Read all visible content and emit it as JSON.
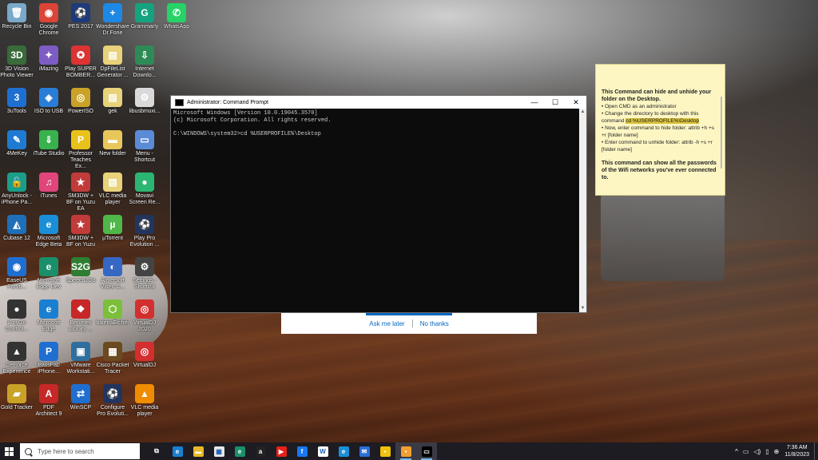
{
  "desktop_icons": [
    {
      "label": "Recycle Bin",
      "color": "#7aa9c9",
      "glyph": "🗑",
      "col": 0,
      "row": 0
    },
    {
      "label": "Google Chrome",
      "color": "#db4437",
      "glyph": "◉",
      "col": 1,
      "row": 0
    },
    {
      "label": "PES 2017",
      "color": "#1d3a7a",
      "glyph": "⚽",
      "col": 2,
      "row": 0
    },
    {
      "label": "Wondershare Dr.Fone",
      "color": "#1e88e5",
      "glyph": "+",
      "col": 3,
      "row": 0
    },
    {
      "label": "Grammarly",
      "color": "#15a37f",
      "glyph": "G",
      "col": 4,
      "row": 0
    },
    {
      "label": "WhatsApp",
      "color": "#25d366",
      "glyph": "✆",
      "col": 5,
      "row": 0
    },
    {
      "label": "3D Vision Photo Viewer",
      "color": "#3a6b3a",
      "glyph": "3D",
      "col": 0,
      "row": 1
    },
    {
      "label": "iMazing",
      "color": "#7d5cc4",
      "glyph": "✦",
      "col": 1,
      "row": 1
    },
    {
      "label": "Play SUPER BOMBER...",
      "color": "#d33",
      "glyph": "✪",
      "col": 2,
      "row": 1
    },
    {
      "label": "DpFileList Generator ...",
      "color": "#e8d27a",
      "glyph": "▤",
      "col": 3,
      "row": 1
    },
    {
      "label": "Internet Downlo...",
      "color": "#2e8b57",
      "glyph": "⇩",
      "col": 4,
      "row": 1
    },
    {
      "label": "3uTools",
      "color": "#1f6fd1",
      "glyph": "3",
      "col": 0,
      "row": 2
    },
    {
      "label": "ISO to USB",
      "color": "#2a7dd6",
      "glyph": "◈",
      "col": 1,
      "row": 2
    },
    {
      "label": "PowerISO",
      "color": "#c9a227",
      "glyph": "◎",
      "col": 2,
      "row": 2
    },
    {
      "label": "gek",
      "color": "#e8d27a",
      "glyph": "▤",
      "col": 3,
      "row": 2
    },
    {
      "label": "libusbmuxi...",
      "color": "#d9d9d9",
      "glyph": "⚙",
      "col": 4,
      "row": 2
    },
    {
      "label": "4MeKey",
      "color": "#1f7ad1",
      "glyph": "✎",
      "col": 0,
      "row": 3
    },
    {
      "label": "iTube Studio",
      "color": "#37b24d",
      "glyph": "⇓",
      "col": 1,
      "row": 3
    },
    {
      "label": "Professor Teaches Ex...",
      "color": "#e8c21a",
      "glyph": "P",
      "col": 2,
      "row": 3
    },
    {
      "label": "New folder",
      "color": "#e8c75a",
      "glyph": "▬",
      "col": 3,
      "row": 3
    },
    {
      "label": "Menu - Shortcut",
      "color": "#5b8bd6",
      "glyph": "▭",
      "col": 4,
      "row": 3
    },
    {
      "label": "AnyUnlock - iPhone Pa...",
      "color": "#1a9e8a",
      "glyph": "🔓",
      "col": 0,
      "row": 4
    },
    {
      "label": "iTunes",
      "color": "#e0457b",
      "glyph": "♫",
      "col": 1,
      "row": 4
    },
    {
      "label": "SM3DW + BF on Yuzu EA",
      "color": "#c23b3b",
      "glyph": "★",
      "col": 2,
      "row": 4
    },
    {
      "label": "VLC media player",
      "color": "#e8d27a",
      "glyph": "▤",
      "col": 3,
      "row": 4
    },
    {
      "label": "Movavi Screen Re...",
      "color": "#2bb673",
      "glyph": "●",
      "col": 4,
      "row": 4
    },
    {
      "label": "Cubase 12",
      "color": "#1e6fb8",
      "glyph": "◭",
      "col": 0,
      "row": 5
    },
    {
      "label": "Microsoft Edge Beta",
      "color": "#1a8fd8",
      "glyph": "e",
      "col": 1,
      "row": 5
    },
    {
      "label": "SM3DW + BF on Yuzu",
      "color": "#c23b3b",
      "glyph": "★",
      "col": 2,
      "row": 5
    },
    {
      "label": "µTorrent",
      "color": "#4fb848",
      "glyph": "µ",
      "col": 3,
      "row": 5
    },
    {
      "label": "Play Pro Evolution ...",
      "color": "#22355f",
      "glyph": "⚽",
      "col": 4,
      "row": 5
    },
    {
      "label": "EaseUS Partiti...",
      "color": "#1f6fd1",
      "glyph": "◉",
      "col": 0,
      "row": 6
    },
    {
      "label": "Microsoft Edge Dev",
      "color": "#1a8f6a",
      "glyph": "e",
      "col": 1,
      "row": 6
    },
    {
      "label": "Speech2Go",
      "color": "#2e7d32",
      "glyph": "S2G",
      "col": 2,
      "row": 6
    },
    {
      "label": "Aimersoft Video C...",
      "color": "#3567c4",
      "glyph": "◐",
      "col": 3,
      "row": 6
    },
    {
      "label": "Settings - Shortcut",
      "color": "#444",
      "glyph": "⚙",
      "col": 4,
      "row": 6
    },
    {
      "label": "iAnyGo Control...",
      "color": "#333",
      "glyph": "●",
      "col": 0,
      "row": 7
    },
    {
      "label": "Microsoft Edge",
      "color": "#1a7fd1",
      "glyph": "e",
      "col": 1,
      "row": 7
    },
    {
      "label": "Berkeley Library ...",
      "color": "#c62828",
      "glyph": "❖",
      "col": 2,
      "row": 7
    },
    {
      "label": "balenaEtcher",
      "color": "#7bbf3a",
      "glyph": "⬡",
      "col": 3,
      "row": 7
    },
    {
      "label": "VirtualDJ 2020",
      "color": "#d32f2f",
      "glyph": "◎",
      "col": 4,
      "row": 7
    },
    {
      "label": "GeForce Experience",
      "color": "#333",
      "glyph": "▲",
      "col": 0,
      "row": 8
    },
    {
      "label": "PassFab iPhone...",
      "color": "#1f6fd1",
      "glyph": "P",
      "col": 1,
      "row": 8
    },
    {
      "label": "VMware Workstati...",
      "color": "#2e6f9e",
      "glyph": "▣",
      "col": 2,
      "row": 8
    },
    {
      "label": "Cisco Packet Tracer",
      "color": "#6b4a1f",
      "glyph": "▦",
      "col": 3,
      "row": 8
    },
    {
      "label": "VirtualDJ",
      "color": "#d32f2f",
      "glyph": "◎",
      "col": 4,
      "row": 8
    },
    {
      "label": "Gold Tracker",
      "color": "#c9a227",
      "glyph": "▰",
      "col": 0,
      "row": 9
    },
    {
      "label": "PDF Architect 9",
      "color": "#c62828",
      "glyph": "A",
      "col": 1,
      "row": 9
    },
    {
      "label": "WinSCP",
      "color": "#1f6fd1",
      "glyph": "⇄",
      "col": 2,
      "row": 9
    },
    {
      "label": "Configure Pro Evoluti...",
      "color": "#22355f",
      "glyph": "⚽",
      "col": 3,
      "row": 9
    },
    {
      "label": "VLC media player",
      "color": "#f08c00",
      "glyph": "▲",
      "col": 4,
      "row": 9
    }
  ],
  "note": {
    "heading": "This Command can hide and unhide your folder on the Desktop.",
    "b1": "• Open CMD as an administrator",
    "b2a": "• Change the directory to desktop with this command ",
    "b2_highlight": "cd %USERPROFILE%\\Desktop",
    "b3": "• Now, enter command to hide folder: attrib +h +s +r [folder name]",
    "b4": "• Enter command to unhide folder: attrib -h +s +r [folder name]",
    "footer": "This command can show all the passwords of the Wifi networks you've ever connected to."
  },
  "cmd": {
    "title": "Administrator: Command Prompt",
    "lines": "Microsoft Windows [Version 10.0.19045.3570]\n(c) Microsoft Corporation. All rights reserved.\n\nC:\\WINDOWS\\system32>cd %USERPROFILE%\\Desktop",
    "minimize": "—",
    "maximize": "☐",
    "close": "✕"
  },
  "dialog": {
    "ask_later": "Ask me later",
    "no_thanks": "No thanks"
  },
  "taskbar": {
    "search_placeholder": "Type here to search",
    "apps": [
      {
        "name": "task-view",
        "color": "#1c1c22",
        "glyph": "⧉"
      },
      {
        "name": "edge",
        "color": "#1a7fd1",
        "glyph": "e"
      },
      {
        "name": "file-explorer",
        "color": "#e8b92a",
        "glyph": "▬"
      },
      {
        "name": "store",
        "color": "#e8e8e8",
        "glyph": "▦"
      },
      {
        "name": "edge-dev",
        "color": "#1a8f6a",
        "glyph": "e"
      },
      {
        "name": "amazon",
        "color": "#222",
        "glyph": "a"
      },
      {
        "name": "youtube",
        "color": "#e62117",
        "glyph": "▶"
      },
      {
        "name": "facebook",
        "color": "#1877f2",
        "glyph": "f"
      },
      {
        "name": "word",
        "color": "#fff",
        "glyph": "W"
      },
      {
        "name": "edge-beta",
        "color": "#1a8fd8",
        "glyph": "e"
      },
      {
        "name": "mail",
        "color": "#2a6fd6",
        "glyph": "✉"
      },
      {
        "name": "sticky-notes",
        "color": "#f0c20e",
        "glyph": "▪"
      },
      {
        "name": "notes",
        "color": "#f0a030",
        "glyph": "▪"
      },
      {
        "name": "command-prompt",
        "color": "#000",
        "glyph": "▭"
      }
    ],
    "time": "7:36 AM",
    "date": "11/8/2023"
  }
}
